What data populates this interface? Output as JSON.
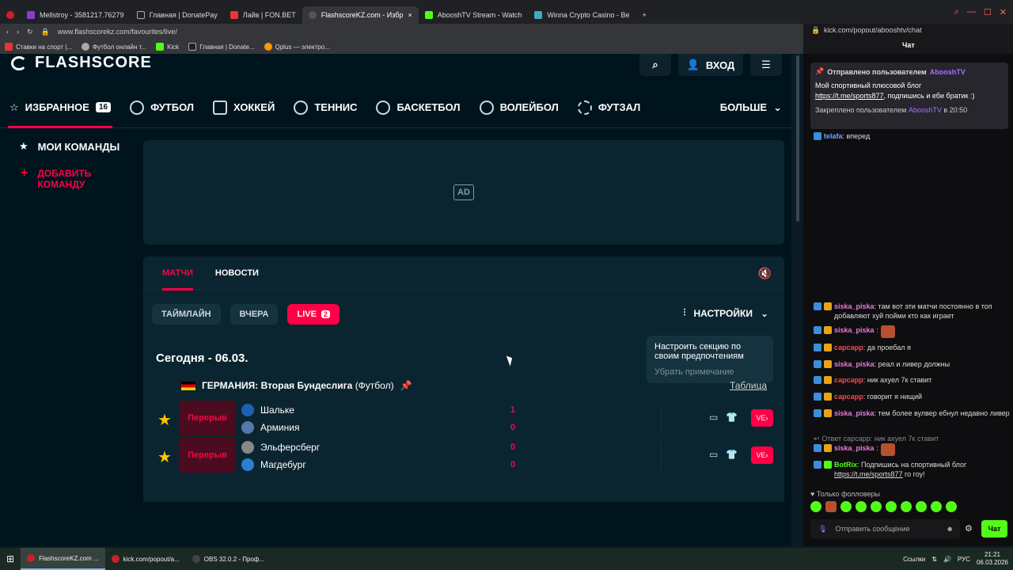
{
  "browser": {
    "tabs": [
      {
        "label": "Mellstroy - 3581217.76279"
      },
      {
        "label": "Главная | DonatePay"
      },
      {
        "label": "Лайв | FON.BET"
      },
      {
        "label": "FlashscoreKZ.com - Избр"
      },
      {
        "label": "AbooshTV Stream - Watch"
      },
      {
        "label": "Winna Crypto Casino - Be"
      }
    ],
    "url": "www.flashscorekz.com/favourites/live/",
    "right_url": "kick.com/popout/abooshtv/chat",
    "right_title": "Чат",
    "bookmarks": [
      "Ставки на спорт |...",
      "Футбол онлайн т...",
      "Kick",
      "Главная | Donate...",
      "Qplus — электро..."
    ]
  },
  "header": {
    "logo": "FLASHSCORE",
    "login": "ВХОД"
  },
  "sports_nav": {
    "favorites": "ИЗБРАННОЕ",
    "favorites_count": "16",
    "items": [
      "ФУТБОЛ",
      "ХОККЕЙ",
      "ТЕННИС",
      "БАСКЕТБОЛ",
      "ВОЛЕЙБОЛ",
      "ФУТЗАЛ"
    ],
    "more": "БОЛЬШЕ"
  },
  "sidebar": {
    "my_teams": "МОИ КОМАНДЫ",
    "add_team_1": "ДОБАВИТЬ",
    "add_team_2": "КОМАНДУ"
  },
  "ad": {
    "label": "AD"
  },
  "panel": {
    "tabs": [
      "МАТЧИ",
      "НОВОСТИ"
    ],
    "filters": {
      "timeline": "ТАЙМЛАЙН",
      "yesterday": "ВЧЕРА",
      "live": "LIVE",
      "live_count": "2"
    },
    "settings": "НАСТРОЙКИ",
    "tooltip": {
      "text": "Настроить секцию по своим предпочтениям",
      "remove": "Убрать примечание"
    },
    "date_heading": "Сегодня - 06.03.",
    "league": {
      "country": "ГЕРМАНИЯ:",
      "name": "Вторая Бундеслига",
      "sport": "(Футбол)",
      "table": "Таблица"
    },
    "matches": [
      {
        "status": "Перерыв",
        "home": "Шальке",
        "away": "Арминия",
        "home_score": "1",
        "away_score": "0",
        "live_label": "VE"
      },
      {
        "status": "Перерыв",
        "home": "Эльферсберг",
        "away": "Магдебург",
        "home_score": "0",
        "away_score": "0",
        "live_label": "VE"
      }
    ]
  },
  "chat": {
    "pinned": {
      "header": "Отправлено пользователем",
      "author": "AbooshTV",
      "text": "Мой спортивный плюсовой блог",
      "link": "https://t.me/sports877",
      "text2": ", подпишись и еби братик :)",
      "pinned_by": "Закреплено пользователем",
      "pinned_time": "в 20:50"
    },
    "messages": [
      {
        "user": "telafa",
        "text": ": вперед"
      },
      {
        "user": "siska_piska",
        "text": ": там вот эти матчи постоянно в топ добавляют хуй пойми кто как играет"
      },
      {
        "user": "siska_piska",
        "text": ":"
      },
      {
        "user": "сарсарр",
        "text": ": да проебал я"
      },
      {
        "user": "siska_piska",
        "text": ": реал и ливер должны"
      },
      {
        "user": "сарсарр",
        "text": ": ник ахуел 7к ставит"
      },
      {
        "user": "сарсарр",
        "text": ": говорит я нищий"
      },
      {
        "user": "siska_piska",
        "text": ": тем более вулвер ебнул недавно ливер"
      },
      {
        "user": "siska_piska",
        "text": ":"
      },
      {
        "user": "BotRix",
        "text": ": Подпишись на спортивный блог"
      }
    ],
    "reply_note": "Ответ сарсарр: ник ахуел 7к ставит",
    "botrix_link": "https://t.me/sports877",
    "botrix_tail": " го гоу!",
    "followers_only": "Только фолловеры",
    "input_placeholder": "Отправить сообщение",
    "send": "Чат"
  },
  "taskbar": {
    "items": [
      "FlashscoreKZ.com ...",
      "kick.com/popout/a...",
      "OBS 32.0.2 - Проф..."
    ],
    "links": "Ссылки",
    "lang": "РУС",
    "time": "21:21",
    "date": "06.03.2026"
  }
}
